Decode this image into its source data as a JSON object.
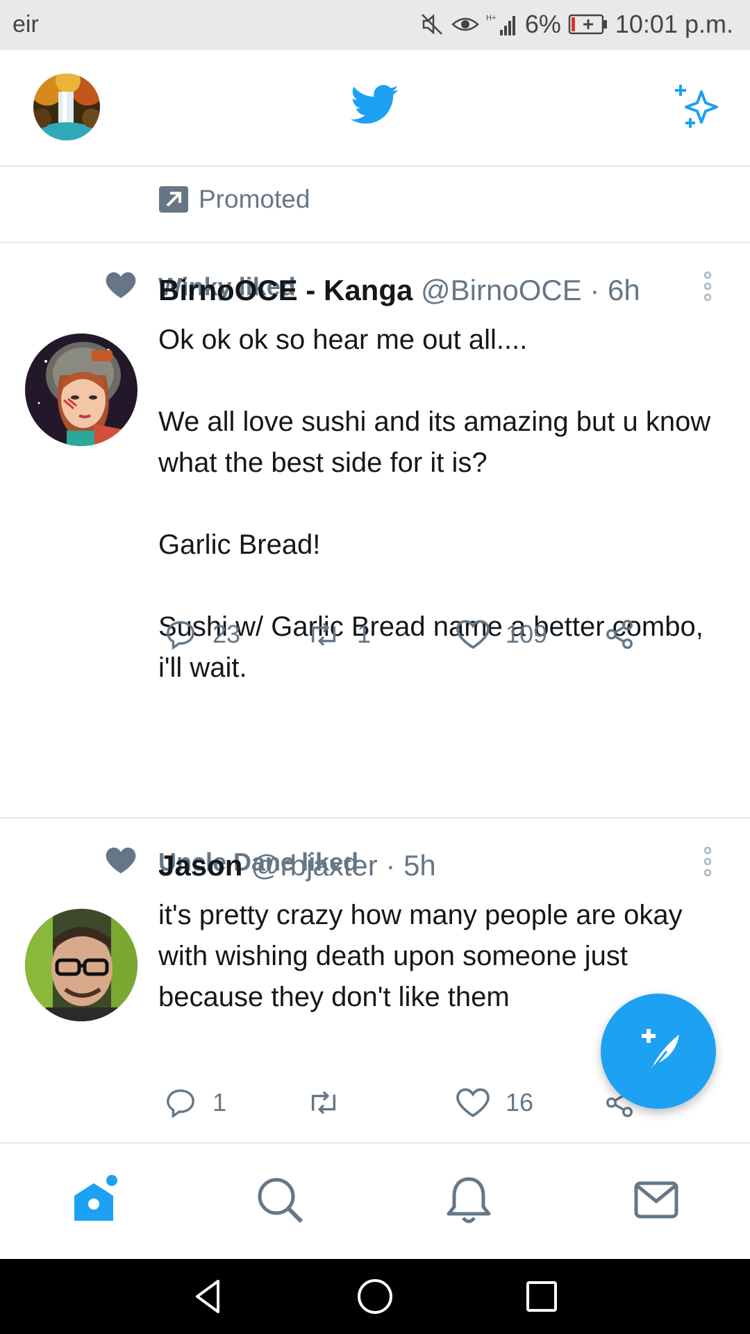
{
  "status_bar": {
    "carrier": "eir",
    "battery": "6%",
    "time": "10:01 p.m."
  },
  "app_bar": {
    "avatar": "waterfall-profile-photo",
    "logo": "twitter-bird-icon",
    "action": "sparkle-icon"
  },
  "promoted": {
    "label": "Promoted"
  },
  "tweets": [
    {
      "liked_by": "Winky liked",
      "name": "BirnoOCE - Kanga",
      "handle": "@BirnoOCE",
      "time": "· 6h",
      "paragraphs": [
        "Ok ok ok so hear me out all....",
        "We all love sushi and its amazing but u know what the best side for it is?",
        "Garlic Bread!",
        "Sushi w/ Garlic Bread name a better combo, i'll wait."
      ],
      "replies": "23",
      "retweets": "1",
      "likes": "109"
    },
    {
      "liked_by": "Uncle Dane liked",
      "name": "Jason",
      "handle": "@rbjaxter",
      "time": "· 5h",
      "paragraphs": [
        "it's pretty crazy how many people are okay with wishing death upon someone just because they don't like them"
      ],
      "replies": "1",
      "retweets": "",
      "likes": "16"
    }
  ],
  "colors": {
    "accent": "#1da1f2",
    "secondary_text": "#657786",
    "divider": "#e1e8ed"
  },
  "bottom_nav": [
    "home-icon",
    "search-icon",
    "notifications-icon",
    "messages-icon"
  ],
  "system_nav": [
    "back-icon",
    "home-circle-icon",
    "recents-icon"
  ]
}
